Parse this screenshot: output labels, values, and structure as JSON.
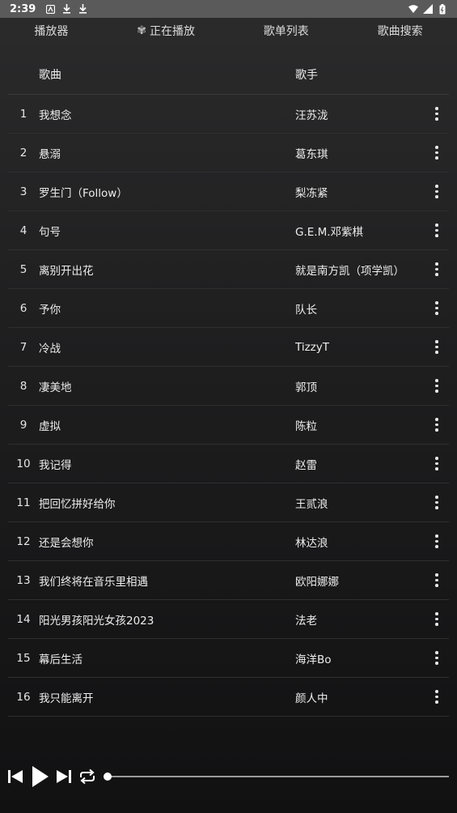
{
  "status_bar": {
    "time": "2:39"
  },
  "tabs": [
    {
      "label": "播放器"
    },
    {
      "label": "正在播放"
    },
    {
      "label": "歌单列表"
    },
    {
      "label": "歌曲搜索"
    }
  ],
  "table": {
    "headers": {
      "title": "歌曲",
      "artist": "歌手"
    },
    "rows": [
      {
        "num": "1",
        "title": "我想念",
        "artist": "汪苏泷"
      },
      {
        "num": "2",
        "title": "悬溺",
        "artist": "葛东琪"
      },
      {
        "num": "3",
        "title": "罗生门（Follow）",
        "artist": "梨冻紧"
      },
      {
        "num": "4",
        "title": "句号",
        "artist": "G.E.M.邓紫棋"
      },
      {
        "num": "5",
        "title": "离别开出花",
        "artist": "就是南方凯（项学凯）"
      },
      {
        "num": "6",
        "title": "予你",
        "artist": "队长"
      },
      {
        "num": "7",
        "title": "冷战",
        "artist": "TizzyT"
      },
      {
        "num": "8",
        "title": "凄美地",
        "artist": "郭顶"
      },
      {
        "num": "9",
        "title": "虚拟",
        "artist": "陈粒"
      },
      {
        "num": "10",
        "title": "我记得",
        "artist": "赵雷"
      },
      {
        "num": "11",
        "title": "把回忆拼好给你",
        "artist": "王贰浪"
      },
      {
        "num": "12",
        "title": "还是会想你",
        "artist": "林达浪"
      },
      {
        "num": "13",
        "title": "我们终将在音乐里相遇",
        "artist": "欧阳娜娜"
      },
      {
        "num": "14",
        "title": "阳光男孩阳光女孩2023",
        "artist": "法老"
      },
      {
        "num": "15",
        "title": "幕后生活",
        "artist": "海洋Bo"
      },
      {
        "num": "16",
        "title": "我只能离开",
        "artist": "颜人中"
      }
    ]
  },
  "player": {
    "progress_fraction": 0.0,
    "icons": [
      "skip-previous-icon",
      "play-icon",
      "skip-next-icon",
      "repeat-icon"
    ]
  }
}
